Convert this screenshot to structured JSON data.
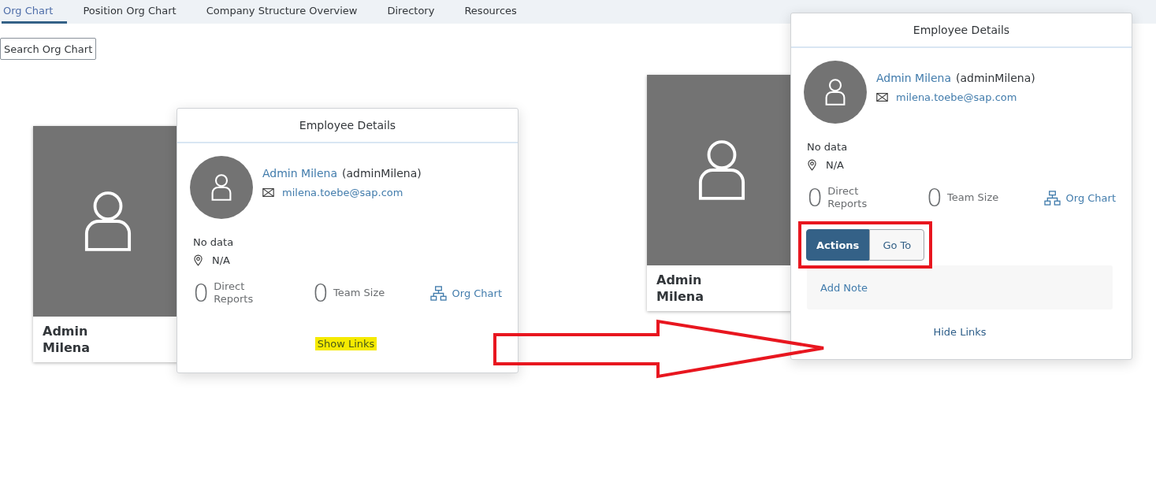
{
  "tabs": [
    {
      "label": "Org Chart",
      "selected": true
    },
    {
      "label": "Position Org Chart",
      "selected": false
    },
    {
      "label": "Company Structure Overview",
      "selected": false
    },
    {
      "label": "Directory",
      "selected": false
    },
    {
      "label": "Resources",
      "selected": false
    }
  ],
  "search_button": {
    "label": "Search Org Chart"
  },
  "panels": [
    {
      "card": {
        "name": "Admin Milena"
      },
      "popover": {
        "title": "Employee Details",
        "name": "Admin Milena",
        "user_id": "(adminMilena)",
        "email": "milena.toebe@sap.com",
        "status": "No data",
        "location": "N/A",
        "stats": [
          {
            "value": "0",
            "label": "Direct Reports"
          },
          {
            "value": "0",
            "label": "Team Size"
          }
        ],
        "org_chart_link": "Org Chart",
        "toggle_link": {
          "label": "Show Links",
          "highlighted": true
        }
      }
    },
    {
      "card": {
        "name": "Admin Milena"
      },
      "popover": {
        "title": "Employee Details",
        "name": "Admin Milena",
        "user_id": "(adminMilena)",
        "email": "milena.toebe@sap.com",
        "status": "No data",
        "location": "N/A",
        "stats": [
          {
            "value": "0",
            "label": "Direct Reports"
          },
          {
            "value": "0",
            "label": "Team Size"
          }
        ],
        "org_chart_link": "Org Chart",
        "link_buttons": {
          "outlined": true,
          "items": [
            {
              "label": "Actions",
              "selected": true
            },
            {
              "label": "Go To",
              "selected": false
            }
          ]
        },
        "links": [
          {
            "label": "Add Note"
          }
        ],
        "toggle_link": {
          "label": "Hide Links",
          "highlighted": false
        }
      }
    }
  ],
  "annotations": [
    {
      "kind": "arrow"
    }
  ]
}
